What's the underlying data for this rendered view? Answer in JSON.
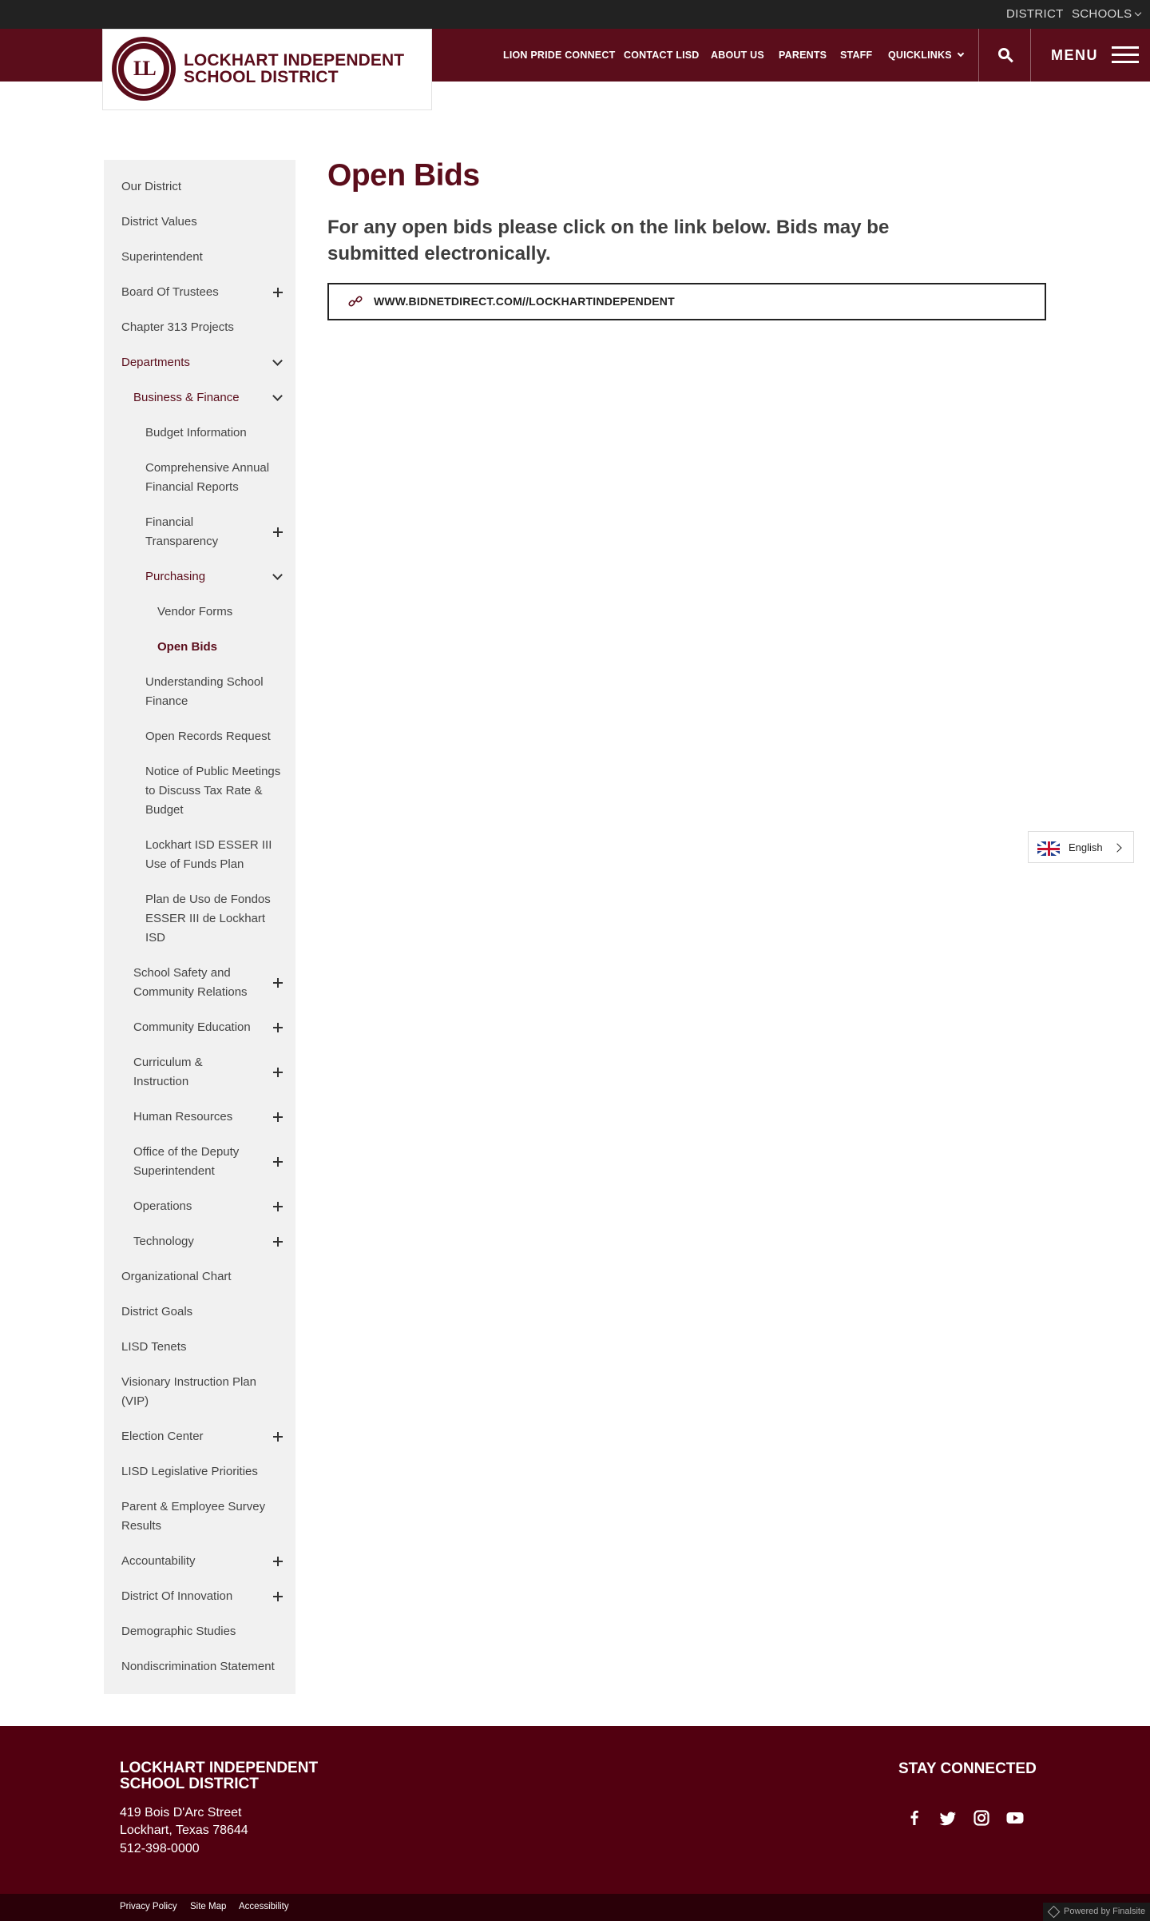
{
  "utility": {
    "district": "DISTRICT",
    "schools": "SCHOOLS"
  },
  "logo": {
    "name": "LOCKHART INDEPENDENT SCHOOL DISTRICT"
  },
  "nav": {
    "items": [
      "LION PRIDE CONNECT",
      "CONTACT LISD",
      "ABOUT US",
      "PARENTS",
      "STAFF",
      "QUICKLINKS"
    ],
    "menu": "MENU"
  },
  "sidebar": {
    "items": [
      "Our District",
      "District Values",
      "Superintendent",
      "Board Of Trustees",
      "Chapter 313 Projects",
      "Departments",
      "Business & Finance",
      "Budget Information",
      "Comprehensive Annual Financial Reports",
      "Financial Transparency",
      "Purchasing",
      "Vendor Forms",
      "Open Bids",
      "Understanding School Finance",
      "Open Records Request",
      "Notice of Public Meetings to Discuss Tax Rate & Budget",
      "Lockhart ISD ESSER III Use of Funds Plan",
      "Plan de Uso de Fondos ESSER III de Lockhart ISD",
      "School Safety and Community Relations",
      "Community Education",
      "Curriculum & Instruction",
      "Human Resources",
      "Office of the Deputy Superintendent",
      "Operations",
      "Technology",
      "Organizational Chart",
      "District Goals",
      "LISD Tenets",
      "Visionary Instruction Plan (VIP)",
      "Election Center",
      "LISD Legislative Priorities",
      "Parent & Employee Survey Results",
      "Accountability",
      "District Of Innovation",
      "Demographic Studies",
      "Nondiscrimination Statement"
    ]
  },
  "main": {
    "title": "Open Bids",
    "intro": "For any open bids please click on the link below. Bids may be submitted electronically.",
    "link_label": "WWW.BIDNETDIRECT.COM//LOCKHARTINDEPENDENT"
  },
  "language": {
    "label": "English"
  },
  "footer": {
    "name": "LOCKHART INDEPENDENT SCHOOL DISTRICT",
    "address_line1": "419 Bois D'Arc Street",
    "address_line2": "Lockhart, Texas  78644",
    "phone": "512-398-0000",
    "stay_connected": "STAY CONNECTED",
    "social": [
      "facebook-icon",
      "twitter-icon",
      "instagram-icon",
      "youtube-icon"
    ],
    "links": [
      "Privacy Policy",
      "Site Map",
      "Accessibility"
    ],
    "powered": "Powered by Finalsite"
  },
  "colors": {
    "brand": "#5b0d1b",
    "footer": "#520010",
    "topbar": "#222222"
  }
}
